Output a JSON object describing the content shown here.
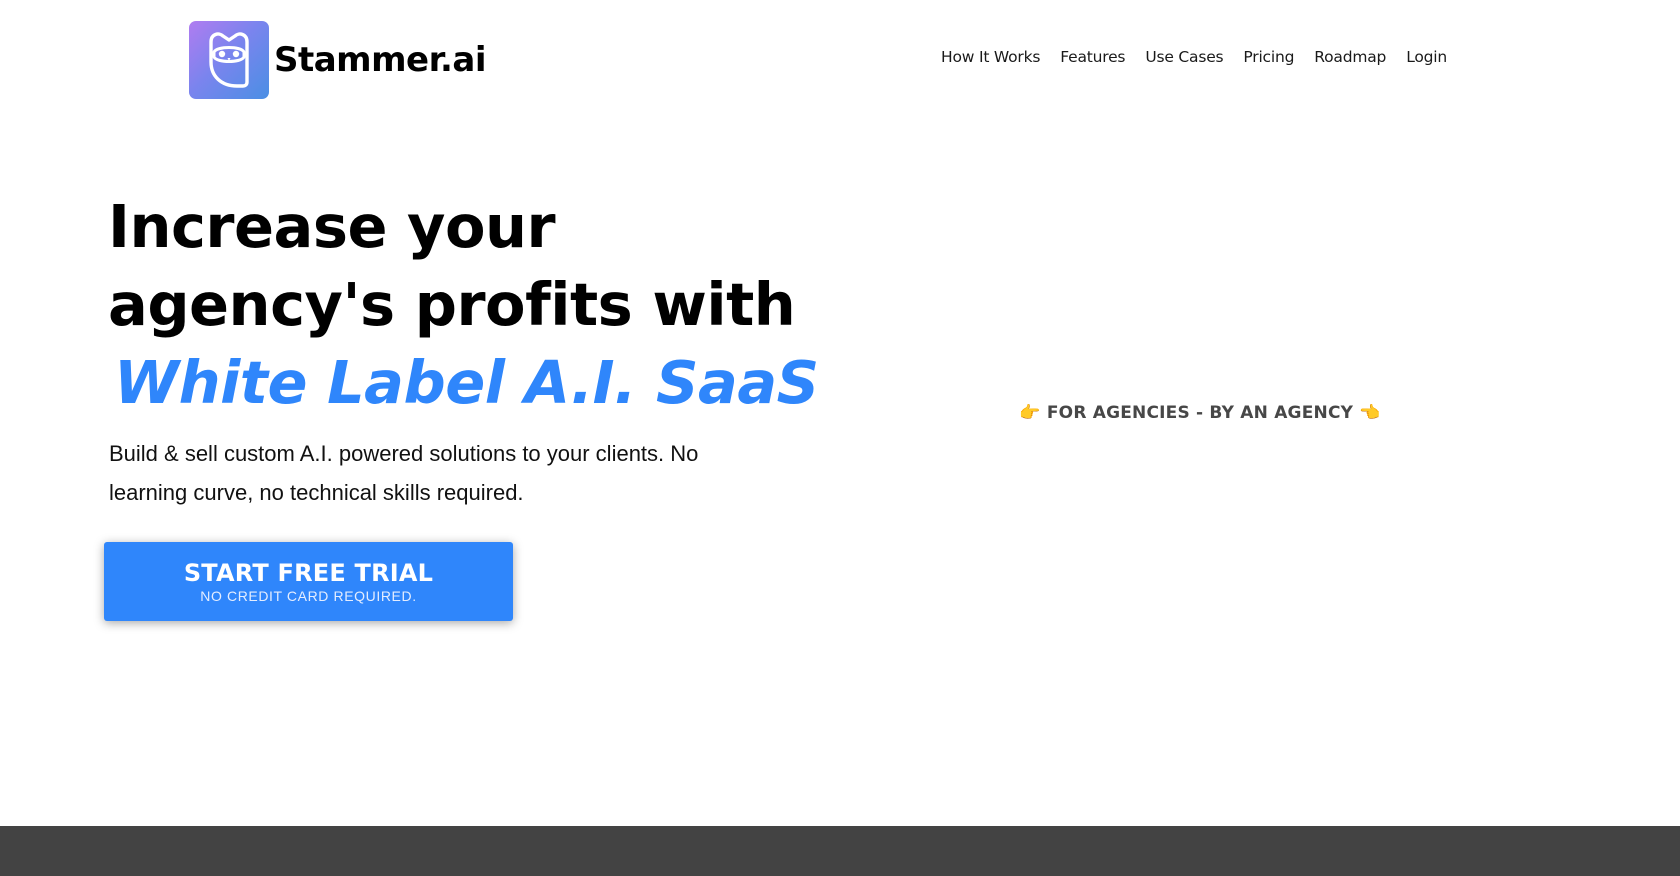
{
  "header": {
    "brand_name": "Stammer.ai",
    "logo_icon": "owl-icon",
    "nav": [
      {
        "label": "How It Works"
      },
      {
        "label": "Features"
      },
      {
        "label": "Use Cases"
      },
      {
        "label": "Pricing"
      },
      {
        "label": "Roadmap"
      },
      {
        "label": "Login"
      }
    ]
  },
  "hero": {
    "title_line1": "Increase your",
    "title_line2": "agency's profits with",
    "title_accent": "White Label A.I. SaaS",
    "subtitle": "Build & sell custom A.I. powered solutions to your clients. No learning curve, no technical skills required.",
    "cta": {
      "label": "START FREE TRIAL",
      "sublabel": "NO CREDIT CARD REQUIRED."
    }
  },
  "tagline": {
    "left_icon": "pointing-right-hand-icon",
    "left_glyph": "👉",
    "text": "FOR AGENCIES - BY AN AGENCY",
    "right_icon": "pointing-left-hand-icon",
    "right_glyph": "👈"
  },
  "colors": {
    "accent": "#2f86fb",
    "footer_band": "#434343",
    "tagline_text": "#474747"
  }
}
